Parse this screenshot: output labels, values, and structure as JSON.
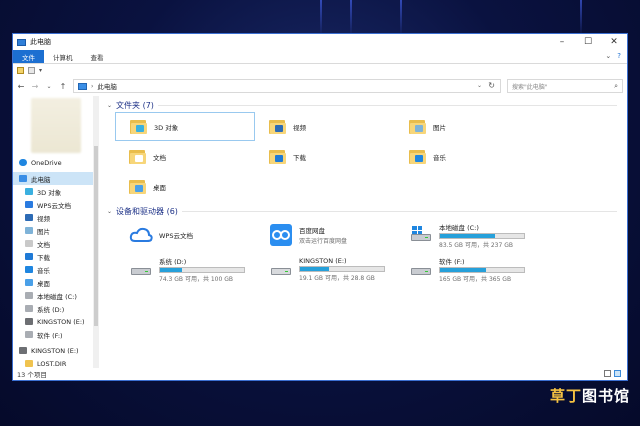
{
  "window": {
    "title": "此电脑",
    "controls": [
      "minimize",
      "maximize",
      "close"
    ]
  },
  "ribbon": {
    "tabs": [
      {
        "label": "文件",
        "active": true
      },
      {
        "label": "计算机",
        "active": false
      },
      {
        "label": "查看",
        "active": false
      }
    ]
  },
  "address": {
    "path": "此电脑",
    "search_placeholder": "搜索\"此电脑\""
  },
  "sidebar": {
    "items": [
      {
        "label": "OneDrive",
        "icon": "cloud-icon",
        "level": "top"
      },
      {
        "label": "此电脑",
        "icon": "computer-icon",
        "level": "top",
        "selected": true
      },
      {
        "label": "3D 对象",
        "icon": "3d-objects-icon"
      },
      {
        "label": "WPS云文档",
        "icon": "wps-cloud-icon"
      },
      {
        "label": "视频",
        "icon": "video-icon"
      },
      {
        "label": "图片",
        "icon": "pictures-icon"
      },
      {
        "label": "文档",
        "icon": "documents-icon"
      },
      {
        "label": "下载",
        "icon": "download-icon"
      },
      {
        "label": "音乐",
        "icon": "music-icon"
      },
      {
        "label": "桌面",
        "icon": "desktop-icon"
      },
      {
        "label": "本地磁盘 (C:)",
        "icon": "drive-icon"
      },
      {
        "label": "系统 (D:)",
        "icon": "drive-icon"
      },
      {
        "label": "KINGSTON (E:)",
        "icon": "usb-drive-icon"
      },
      {
        "label": "软件 (F:)",
        "icon": "drive-icon"
      },
      {
        "label": "KINGSTON (E:)",
        "icon": "usb-drive-icon",
        "level": "top"
      },
      {
        "label": "LOST.DIR",
        "icon": "folder-icon"
      }
    ]
  },
  "folders_group": {
    "header": "文件夹 (7)",
    "items": [
      {
        "label": "3D 对象",
        "badge_color": "#3ab0e0",
        "selected": true
      },
      {
        "label": "视频",
        "badge_color": "#2d6bb5"
      },
      {
        "label": "图片",
        "badge_color": "#7fb3d8"
      },
      {
        "label": "文档",
        "badge_color": "#ffffff"
      },
      {
        "label": "下载",
        "badge_color": "#1f7ad6"
      },
      {
        "label": "音乐",
        "badge_color": "#1f86e0"
      },
      {
        "label": "桌面",
        "badge_color": "#4aa0e8"
      }
    ]
  },
  "drives_group": {
    "header": "设备和驱动器 (6)",
    "items": [
      {
        "name": "WPS云文档",
        "type": "cloud",
        "sub": ""
      },
      {
        "name": "百度网盘",
        "type": "baidu",
        "sub": "双击运行百度网盘"
      },
      {
        "name": "本地磁盘 (C:)",
        "type": "system",
        "sub": "83.5 GB 可用，共 237 GB",
        "used_fraction": 0.65
      },
      {
        "name": "系统 (D:)",
        "type": "hdd",
        "sub": "74.3 GB 可用，共 100 GB",
        "used_fraction": 0.26
      },
      {
        "name": "KINGSTON (E:)",
        "type": "usb",
        "sub": "19.1 GB 可用，共 28.8 GB",
        "used_fraction": 0.34
      },
      {
        "name": "软件 (F:)",
        "type": "hdd",
        "sub": "165 GB 可用，共 365 GB",
        "used_fraction": 0.55
      }
    ]
  },
  "status": {
    "count": "13 个项目"
  },
  "watermark": {
    "part1": "草丁",
    "part2": "图书馆"
  },
  "colors": {
    "accent": "#1c6fd1",
    "selection": "#cce4f7",
    "bar_fill": "#26a0da",
    "group_header": "#1e3287"
  }
}
